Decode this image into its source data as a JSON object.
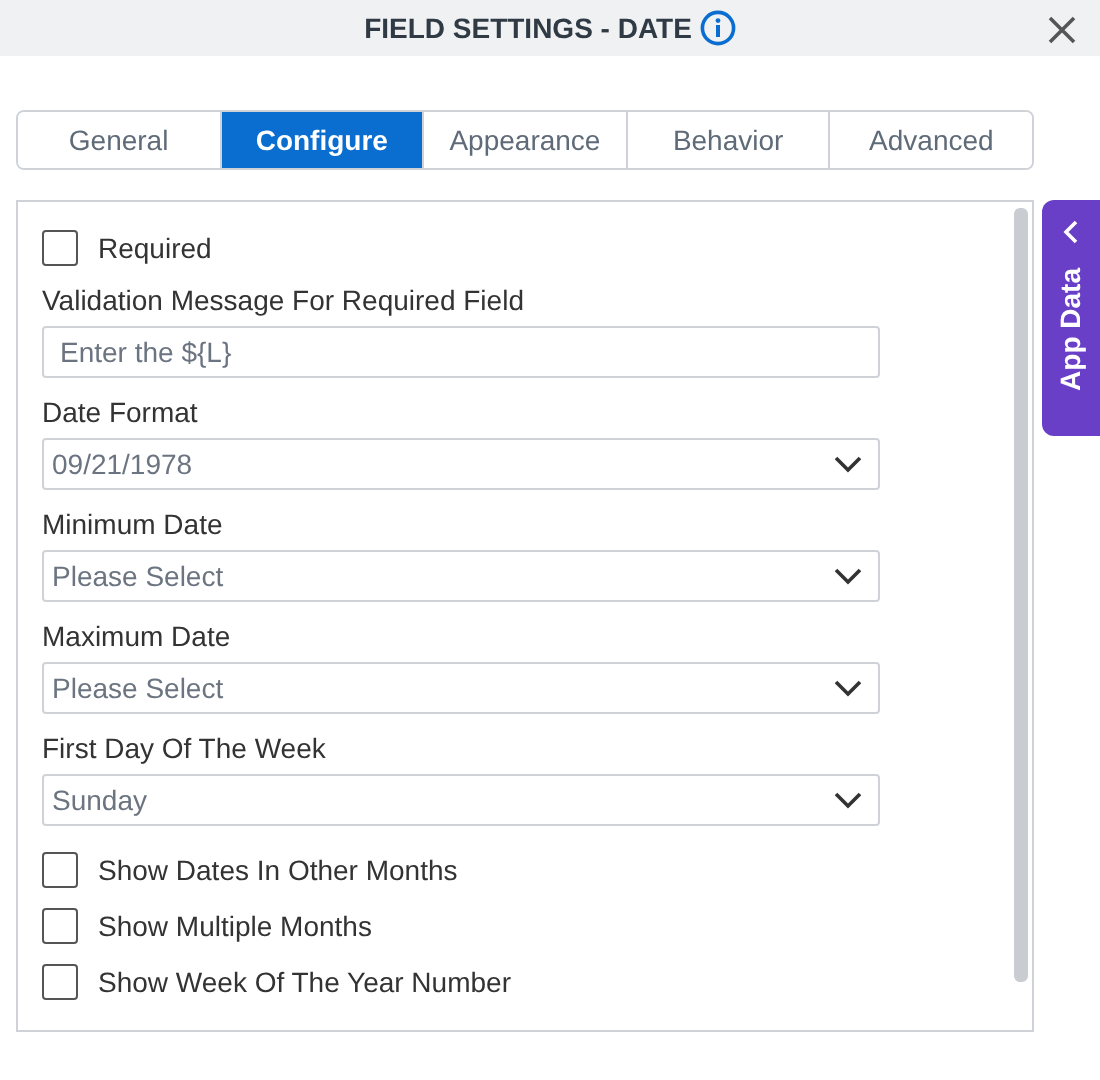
{
  "dialog": {
    "title": "FIELD SETTINGS - DATE"
  },
  "tabs": [
    {
      "label": "General",
      "selected": false
    },
    {
      "label": "Configure",
      "selected": true
    },
    {
      "label": "Appearance",
      "selected": false
    },
    {
      "label": "Behavior",
      "selected": false
    },
    {
      "label": "Advanced",
      "selected": false
    }
  ],
  "side_tab": {
    "label": "App Data"
  },
  "settings": [
    {
      "kind": "checkbox",
      "label": "Required",
      "checked": false
    },
    {
      "kind": "text",
      "label": "Validation Message For Required Field",
      "placeholder": "Enter the ${L}"
    },
    {
      "kind": "select",
      "label": "Date Format",
      "value": "09/21/1978"
    },
    {
      "kind": "select",
      "label": "Minimum Date",
      "value": "Please Select"
    },
    {
      "kind": "select",
      "label": "Maximum Date",
      "value": "Please Select"
    },
    {
      "kind": "select",
      "label": "First Day Of The Week",
      "value": "Sunday"
    },
    {
      "kind": "checkbox",
      "label": "Show Dates In Other Months",
      "checked": false
    },
    {
      "kind": "checkbox",
      "label": "Show Multiple Months",
      "checked": false
    },
    {
      "kind": "checkbox",
      "label": "Show Week Of The Year Number",
      "checked": false
    }
  ]
}
